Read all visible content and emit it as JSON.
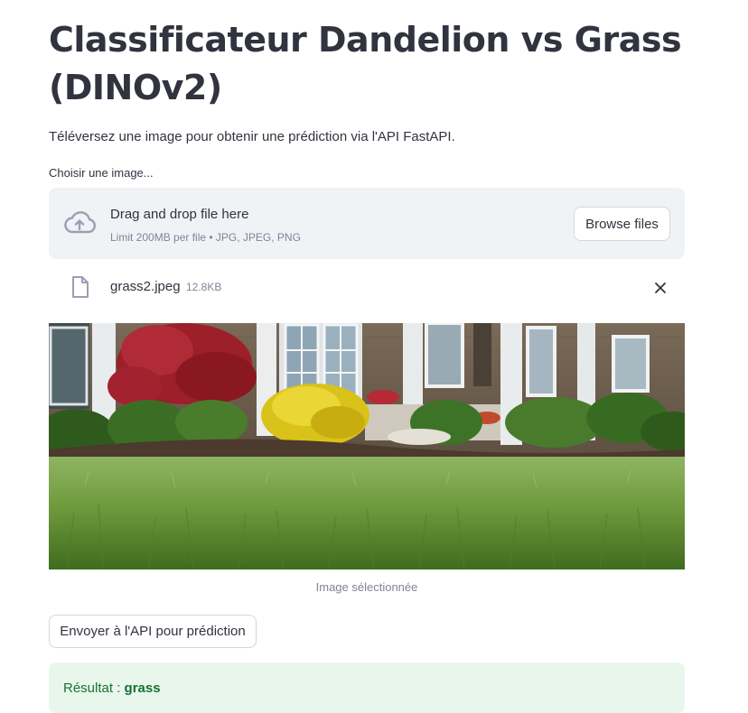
{
  "header": {
    "title": "Classificateur Dandelion vs Grass (DINOv2)",
    "subtitle": "Téléversez une image pour obtenir une prédiction via l'API FastAPI."
  },
  "uploader": {
    "label": "Choisir une image...",
    "dropzone_title": "Drag and drop file here",
    "dropzone_limit": "Limit 200MB per file • JPG, JPEG, PNG",
    "browse_label": "Browse files",
    "upload_icon": "cloud-upload-icon"
  },
  "uploaded_file": {
    "name": "grass2.jpeg",
    "size": "12.8KB",
    "file_icon": "file-icon",
    "remove_icon": "close-icon"
  },
  "image": {
    "caption": "Image sélectionnée"
  },
  "actions": {
    "send_label": "Envoyer à l'API pour prédiction"
  },
  "result": {
    "label": "Résultat :",
    "value": "grass"
  },
  "colors": {
    "text": "#31333f",
    "muted": "#808495",
    "dropzone_bg": "#f0f2f6",
    "success_bg": "#e9f6ec",
    "success_text": "#177233"
  }
}
